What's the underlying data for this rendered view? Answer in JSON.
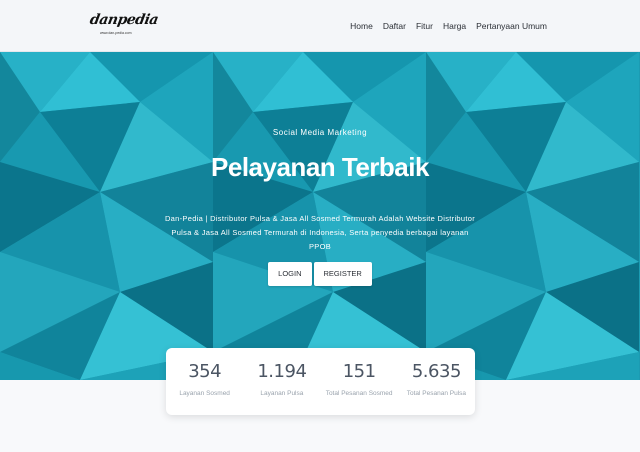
{
  "brand": {
    "logo_text": "danpedia",
    "logo_subtext": "www.dan-pedia.com"
  },
  "nav": {
    "items": [
      "Home",
      "Daftar",
      "Fitur",
      "Harga",
      "Pertanyaan Umum"
    ]
  },
  "hero": {
    "eyebrow": "Social Media Marketing",
    "title": "Pelayanan Terbaik",
    "description": "Dan-Pedia | Distributor Pulsa & Jasa All Sosmed Termurah Adalah Website Distributor Pulsa & Jasa All Sosmed Termurah di Indonesia, Serta penyedia berbagai layanan PPOB",
    "login_label": "LOGIN",
    "register_label": "REGISTER"
  },
  "stats": [
    {
      "value": "354",
      "label": "Layanan Sosmed"
    },
    {
      "value": "1.194",
      "label": "Layanan Pulsa"
    },
    {
      "value": "151",
      "label": "Total Pesanan Sosmed"
    },
    {
      "value": "5.635",
      "label": "Total Pesanan Pulsa"
    }
  ],
  "colors": {
    "hero_base": "#1aa8c0",
    "nav_bg": "#f4f6f9"
  }
}
